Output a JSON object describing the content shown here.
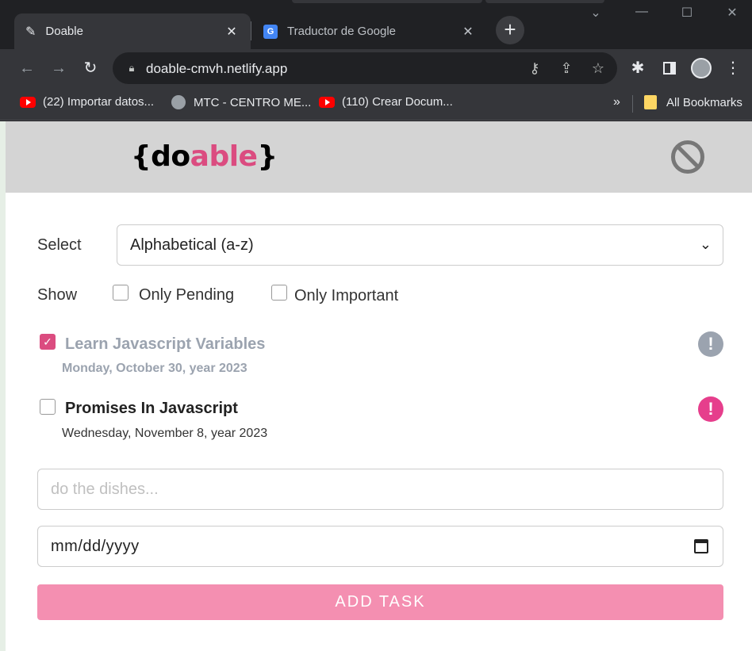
{
  "browser": {
    "tabs": [
      {
        "title": "Doable",
        "icon": "pencil-icon",
        "active": true
      },
      {
        "title": "Traductor de Google",
        "icon": "google-translate-icon",
        "active": false
      }
    ],
    "close_glyph": "✕",
    "new_tab_glyph": "+",
    "url": "doable-cmvh.netlify.app",
    "bookmarks": [
      {
        "label": "(22) Importar datos...",
        "icon": "youtube-icon"
      },
      {
        "label": "MTC - CENTRO ME...",
        "icon": "globe-icon"
      },
      {
        "label": "(110) Crear Docum...",
        "icon": "youtube-icon"
      }
    ],
    "bookmarks_overflow": "»",
    "all_bookmarks": "All Bookmarks"
  },
  "app": {
    "logo": {
      "open": "{",
      "part1": "do",
      "part2": "able",
      "close": "}"
    },
    "colors": {
      "accent": "#db4c80",
      "button": "#f48fb1",
      "header_bg": "#d4d4d4"
    },
    "sort": {
      "label": "Select",
      "value": "Alphabetical (a-z)"
    },
    "filters": {
      "label": "Show",
      "only_pending": "Only Pending",
      "only_important": "Only Important"
    },
    "tasks": [
      {
        "title": "Learn Javascript Variables",
        "date": "Monday, October 30, year 2023",
        "completed": true,
        "important": false
      },
      {
        "title": "Promises In Javascript",
        "date": "Wednesday, November 8, year 2023",
        "completed": false,
        "important": true
      }
    ],
    "form": {
      "task_placeholder": "do the dishes...",
      "date_value": "mm/dd/yyyy",
      "submit_label": "ADD TASK"
    }
  }
}
